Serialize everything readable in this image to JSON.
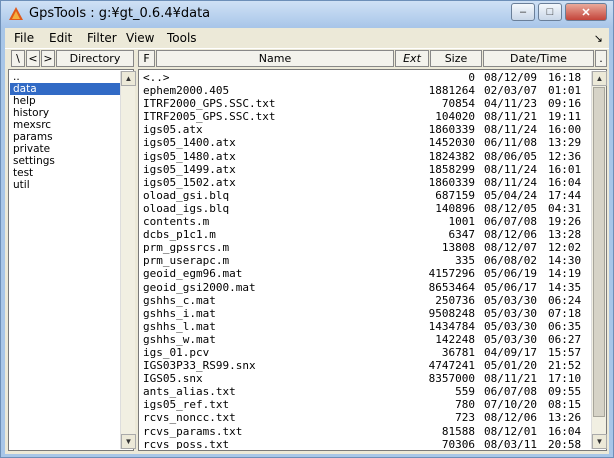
{
  "window": {
    "title": "GpsTools : g:¥gt_0.6.4¥data",
    "controls": {
      "minimize": "–",
      "maximize": "□",
      "close": "✕"
    }
  },
  "menu": {
    "file": "File",
    "edit": "Edit",
    "filter": "Filter",
    "view": "View",
    "tools": "Tools",
    "corner": "↘"
  },
  "toolbar": {
    "root_btn": "\\",
    "back_btn": "<",
    "forward_btn": ">",
    "directory_header": "Directory",
    "f_btn": "F",
    "name_header": "Name",
    "ext_header": "Ext",
    "size_header": "Size",
    "datetime_header": "Date/Time",
    "extra_btn": "."
  },
  "directories": [
    {
      "label": "..",
      "selected": false
    },
    {
      "label": "data",
      "selected": true
    },
    {
      "label": "help",
      "selected": false
    },
    {
      "label": "history",
      "selected": false
    },
    {
      "label": "mexsrc",
      "selected": false
    },
    {
      "label": "params",
      "selected": false
    },
    {
      "label": "private",
      "selected": false
    },
    {
      "label": "settings",
      "selected": false
    },
    {
      "label": "test",
      "selected": false
    },
    {
      "label": "util",
      "selected": false
    }
  ],
  "files": [
    {
      "name": "<..>",
      "size": "0",
      "date": "08/12/09",
      "time": "16:18"
    },
    {
      "name": "ephem2000.405",
      "size": "1881264",
      "date": "02/03/07",
      "time": "01:01"
    },
    {
      "name": "ITRF2000_GPS.SSC.txt",
      "size": "70854",
      "date": "04/11/23",
      "time": "09:16"
    },
    {
      "name": "ITRF2005_GPS.SSC.txt",
      "size": "104020",
      "date": "08/11/21",
      "time": "19:11"
    },
    {
      "name": "igs05.atx",
      "size": "1860339",
      "date": "08/11/24",
      "time": "16:00"
    },
    {
      "name": "igs05_1400.atx",
      "size": "1452030",
      "date": "06/11/08",
      "time": "13:29"
    },
    {
      "name": "igs05_1480.atx",
      "size": "1824382",
      "date": "08/06/05",
      "time": "12:36"
    },
    {
      "name": "igs05_1499.atx",
      "size": "1858299",
      "date": "08/11/24",
      "time": "16:01"
    },
    {
      "name": "igs05_1502.atx",
      "size": "1860339",
      "date": "08/11/24",
      "time": "16:04"
    },
    {
      "name": "oload_gsi.blq",
      "size": "687159",
      "date": "05/04/24",
      "time": "17:44"
    },
    {
      "name": "oload_igs.blq",
      "size": "140896",
      "date": "08/12/05",
      "time": "04:31"
    },
    {
      "name": "contents.m",
      "size": "1001",
      "date": "06/07/08",
      "time": "19:26"
    },
    {
      "name": "dcbs_p1c1.m",
      "size": "6347",
      "date": "08/12/06",
      "time": "13:28"
    },
    {
      "name": "prm_gpssrcs.m",
      "size": "13808",
      "date": "08/12/07",
      "time": "12:02"
    },
    {
      "name": "prm_userapc.m",
      "size": "335",
      "date": "06/08/02",
      "time": "14:30"
    },
    {
      "name": "geoid_egm96.mat",
      "size": "4157296",
      "date": "05/06/19",
      "time": "14:19"
    },
    {
      "name": "geoid_gsi2000.mat",
      "size": "8653464",
      "date": "05/06/17",
      "time": "14:35"
    },
    {
      "name": "gshhs_c.mat",
      "size": "250736",
      "date": "05/03/30",
      "time": "06:24"
    },
    {
      "name": "gshhs_i.mat",
      "size": "9508248",
      "date": "05/03/30",
      "time": "07:18"
    },
    {
      "name": "gshhs_l.mat",
      "size": "1434784",
      "date": "05/03/30",
      "time": "06:35"
    },
    {
      "name": "gshhs_w.mat",
      "size": "142248",
      "date": "05/03/30",
      "time": "06:27"
    },
    {
      "name": "igs_01.pcv",
      "size": "36781",
      "date": "04/09/17",
      "time": "15:57"
    },
    {
      "name": "IGS03P33_RS99.snx",
      "size": "4747241",
      "date": "05/01/20",
      "time": "21:52"
    },
    {
      "name": "IGS05.snx",
      "size": "8357000",
      "date": "08/11/21",
      "time": "17:10"
    },
    {
      "name": "ants_alias.txt",
      "size": "559",
      "date": "06/07/08",
      "time": "09:55"
    },
    {
      "name": "igs05_ref.txt",
      "size": "780",
      "date": "07/10/20",
      "time": "08:15"
    },
    {
      "name": "rcvs_noncc.txt",
      "size": "723",
      "date": "08/12/06",
      "time": "13:26"
    },
    {
      "name": "rcvs_params.txt",
      "size": "81588",
      "date": "08/12/01",
      "time": "16:04"
    },
    {
      "name": "rcvs_poss.txt",
      "size": "70306",
      "date": "08/03/11",
      "time": "20:58"
    }
  ],
  "scroll": {
    "up": "▲",
    "down": "▼"
  }
}
